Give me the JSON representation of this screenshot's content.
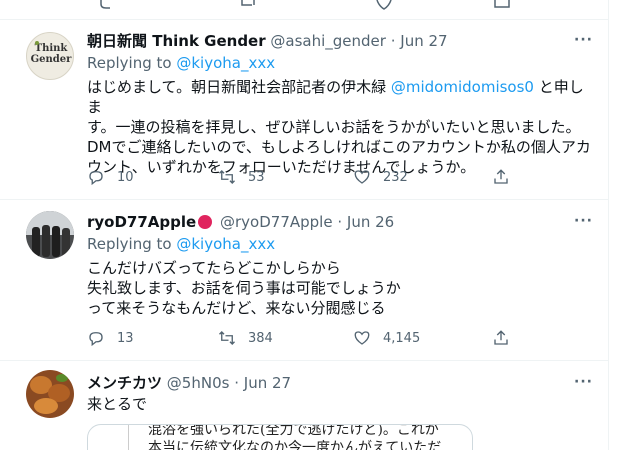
{
  "tweets": [
    {
      "name": "朝日新聞 Think Gender",
      "handle": "@asahi_gender",
      "dot": "·",
      "time": "Jun 27",
      "replying_prefix": "Replying to ",
      "replying_to": "@kiyoha_xxx",
      "body_lines": [
        [
          "はじめまして。朝日新聞社会部記者の伊木緑 ",
          "@midomidomisos0",
          " と申しま"
        ],
        [
          "す。一連の投稿を拝見し、ぜひ詳しいお話をうかがいたいと思いました。",
          "",
          ""
        ],
        [
          "DMでご連絡したいので、もしよろしければこのアカウントか私の個人アカ",
          "",
          ""
        ],
        [
          "ウント、いずれかをフォローいただけませんでしょうか。",
          "",
          ""
        ]
      ],
      "avatar_text": [
        "Think",
        "Gender"
      ],
      "replies": "10",
      "retweets": "53",
      "likes": "232"
    },
    {
      "name": "ryoD77Apple",
      "handle": "@ryoD77Apple",
      "dot": "·",
      "time": "Jun 26",
      "replying_prefix": "Replying to ",
      "replying_to": "@kiyoha_xxx",
      "body_lines": [
        "こんだけバズってたらどこかしらから",
        "失礼致します、お話を伺う事は可能でしょうか",
        "って来そうなもんだけど、来ない分閥感じる"
      ],
      "replies": "13",
      "retweets": "384",
      "likes": "4,145"
    },
    {
      "name": "メンチカツ",
      "handle": "@5hN0s",
      "dot": "·",
      "time": "Jun 27",
      "body_lines": [
        "来とるで"
      ],
      "quote_lines": [
        "混浴を強いられた(全力で逃げたけど)。これが",
        "本当に伝統文化なのか今一度かんがえていただ"
      ]
    }
  ],
  "icons": {
    "more": "more-icon",
    "reply": "reply-icon",
    "retweet": "retweet-icon",
    "like": "heart-icon",
    "share": "share-icon",
    "emoji": "apple-emoji"
  },
  "colors": {
    "link": "#1d9bf0",
    "muted": "#536471",
    "apple": "#e0245e"
  }
}
